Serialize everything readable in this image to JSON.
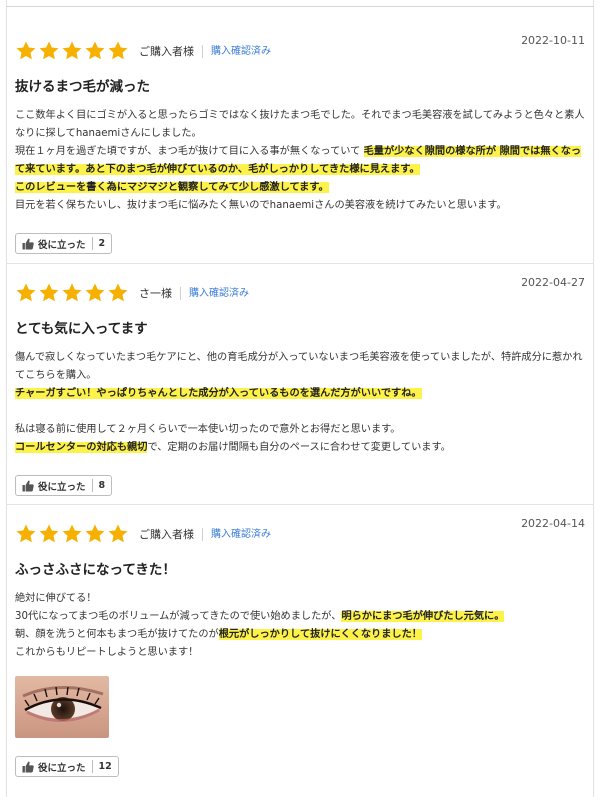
{
  "reviews": [
    {
      "rating": 5,
      "reviewer": "ご購入者様",
      "verified": "購入確認済み",
      "date": "2022-10-11",
      "title": "抜けるまつ毛が減った",
      "lines": [
        [
          {
            "t": "ここ数年よく目にゴミが入ると思ったらゴミではなく抜けたまつ毛でした。それでまつ毛美容液を試してみようと色々と素人"
          }
        ],
        [
          {
            "t": "なりに探してhanaemiさんにしました。"
          }
        ],
        [
          {
            "t": "現在１ヶ月を過ぎた頃ですが、まつ毛が抜けて目に入る事が無くなっていて "
          },
          {
            "t": "毛量が少なく隙間の様な所が 隙間では無くなっ",
            "h": true
          }
        ],
        [
          {
            "t": "て来ています。あと下のまつ毛が伸びているのか、毛がしっかりしてきた様に見えます。",
            "h": true
          }
        ],
        [
          {
            "t": "このレビューを書く為にマジマジと観察してみて少し感激してます。",
            "h": true
          }
        ],
        [
          {
            "t": "目元を若く保ちたいし、抜けまつ毛に悩みたく無いのでhanaemiさんの美容液を続けてみたいと思います。"
          }
        ]
      ],
      "helpful_label": "役に立った",
      "helpful_count": "2"
    },
    {
      "rating": 5,
      "reviewer": "さ一様",
      "verified": "購入確認済み",
      "date": "2022-04-27",
      "title": "とても気に入ってます",
      "lines": [
        [
          {
            "t": "傷んで寂しくなっていたまつ毛ケアにと、他の育毛成分が入っていないまつ毛美容液を使っていましたが、特許成分に惹かれ"
          }
        ],
        [
          {
            "t": "てこちらを購入。"
          }
        ],
        [
          {
            "t": "チャーガすごい！やっぱりちゃんとした成分が入っているものを選んだ方がいいですね。",
            "h": true
          }
        ],
        [],
        [
          {
            "t": "私は寝る前に使用して２ヶ月くらいで一本使い切ったので意外とお得だと思います。"
          }
        ],
        [
          {
            "t": "コールセンターの対応も親切",
            "h": true
          },
          {
            "t": "で、定期のお届け間隔も自分のペースに合わせて変更しています。"
          }
        ]
      ],
      "helpful_label": "役に立った",
      "helpful_count": "8"
    },
    {
      "rating": 5,
      "reviewer": "ご購入者様",
      "verified": "購入確認済み",
      "date": "2022-04-14",
      "title": "ふっさふさになってきた！",
      "lines": [
        [
          {
            "t": "絶対に伸びてる！"
          }
        ],
        [
          {
            "t": "30代になってまつ毛のボリュームが減ってきたので使い始めましたが、"
          },
          {
            "t": "明らかにまつ毛が伸びたし元気に。",
            "h": true
          }
        ],
        [
          {
            "t": "朝、顔を洗うと何本もまつ毛が抜けてたのが"
          },
          {
            "t": "根元がしっかりして抜けにくくなりました！",
            "h": true
          }
        ],
        [
          {
            "t": "これからもリピートしようと思います！"
          }
        ]
      ],
      "has_photo": true,
      "helpful_label": "役に立った",
      "helpful_count": "12"
    }
  ],
  "colors": {
    "star": "#f6b100",
    "highlight": "#fdf24a",
    "link": "#3b7dd8"
  },
  "icons": {
    "star": "star-icon",
    "helpful": "thumbs-up-icon"
  }
}
